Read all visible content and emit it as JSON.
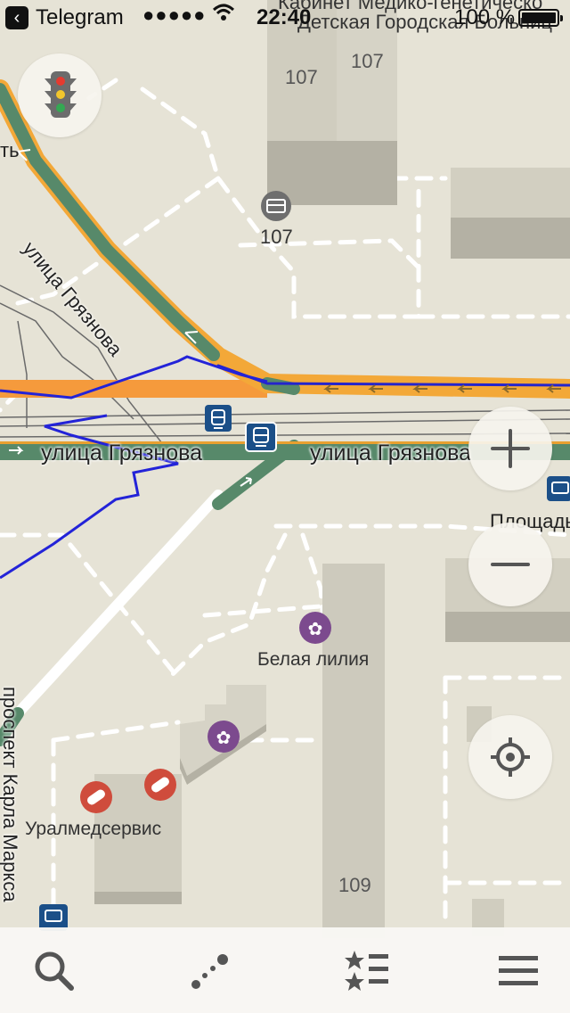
{
  "status_bar": {
    "back_app": "Telegram",
    "signal": "●●●●●",
    "time": "22:40",
    "battery_percent": "100 %"
  },
  "map": {
    "street_top_left": "улица Грязнова",
    "street_left": "улица Грязнова",
    "street_right": "улица Грязнова",
    "street_vertical": "проспект Карла Маркса",
    "partial_left_text": "ть",
    "top_partial_text_1": "Кабинет Медико-генетическо",
    "top_partial_text_2": "Детская Городская Больниц",
    "building_numbers": [
      "107",
      "107",
      "107",
      "109"
    ],
    "poi_right": "Площадь",
    "poi_belaya_liliya": "Белая лилия",
    "poi_uralmedservis": "Уралмедсервис"
  },
  "controls": {
    "traffic_button": "traffic-light-icon",
    "zoom_in": "plus-icon",
    "zoom_out": "minus-icon",
    "my_location": "crosshair-icon"
  },
  "bottom_bar": {
    "search": "search-icon",
    "route": "route-icon",
    "bookmarks": "bookmarks-icon",
    "menu": "menu-icon"
  },
  "colors": {
    "map_bg": "#e6e3d6",
    "building": "#d2cfc1",
    "road_green": "#57896a",
    "road_orange": "#f7a33c",
    "track_blue": "#2222dd",
    "transit_blue": "#1b4f88",
    "poi_purple": "#7c4a8e",
    "poi_red": "#cf4c3c"
  }
}
